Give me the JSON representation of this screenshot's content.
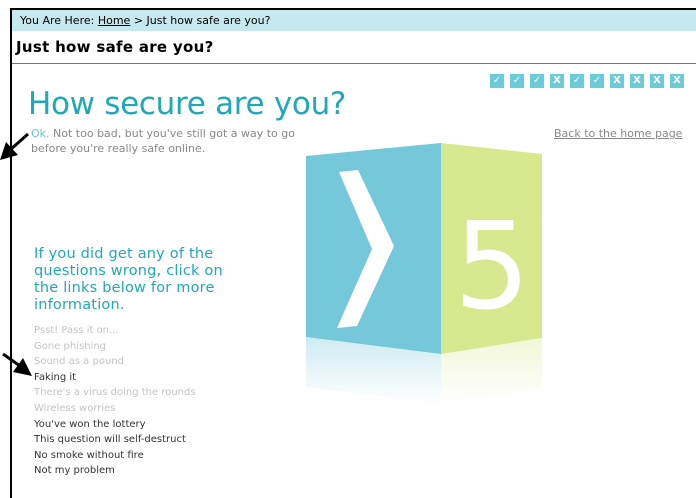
{
  "breadcrumb": {
    "prefix": "You Are Here:",
    "home": "Home",
    "current": "> Just how safe are you?"
  },
  "page": {
    "heading": "Just how safe are you?"
  },
  "progress": [
    "✓",
    "✓",
    "✓",
    "X",
    "✓",
    "✓",
    "X",
    "X",
    "X",
    "X"
  ],
  "result": {
    "title": "How secure are you?",
    "ok": "Ok.",
    "summary": " Not too bad, but you've still got a way to go before you're really safe online.",
    "score": "5",
    "back": "Back to the home page"
  },
  "wrong": {
    "text": "If you did get any of the questions wrong, click on the links below for more information."
  },
  "links": [
    {
      "label": "Psst! Pass it on...",
      "state": "pale"
    },
    {
      "label": "Gone phishing",
      "state": "pale"
    },
    {
      "label": "Sound as a pound",
      "state": "pale"
    },
    {
      "label": "Faking it",
      "state": "dark"
    },
    {
      "label": "There's a virus doing the rounds",
      "state": "pale"
    },
    {
      "label": "Wireless worries",
      "state": "pale"
    },
    {
      "label": "You've won the lottery",
      "state": "dark"
    },
    {
      "label": "This question will self-destruct",
      "state": "dark"
    },
    {
      "label": "No smoke without fire",
      "state": "dark"
    },
    {
      "label": "Not my problem",
      "state": "dark"
    }
  ],
  "colors": {
    "accent": "#1fa9b6",
    "cube_blue": "#74c8d9",
    "cube_green": "#d7e88f",
    "crumb_bg": "#c5e9ef"
  }
}
